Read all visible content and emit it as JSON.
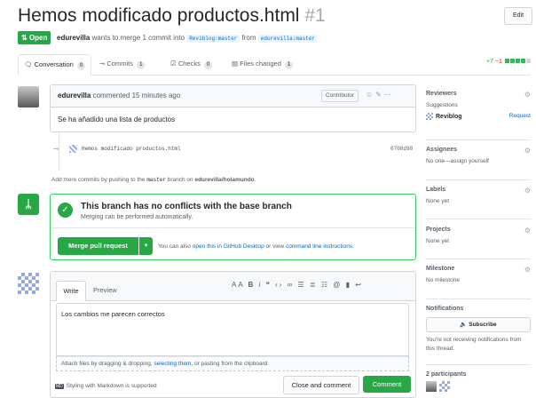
{
  "header": {
    "title": "Hemos modificado productos.html",
    "number": "#1",
    "edit_label": "Edit",
    "status": "Open",
    "author": "edurevilla",
    "meta_text": " wants to merge 1 commit into ",
    "base_branch": "Reviblog:master",
    "from_text": " from ",
    "head_branch": "edurevilla:master"
  },
  "tabs": [
    {
      "label": "Conversation",
      "count": "0"
    },
    {
      "label": "Commits",
      "count": "1"
    },
    {
      "label": "Checks",
      "count": "0"
    },
    {
      "label": "Files changed",
      "count": "1"
    }
  ],
  "diffstat": {
    "additions": "+7",
    "deletions": "−1"
  },
  "comment": {
    "author": "edurevilla",
    "when": " commented 15 minutes ago",
    "badge": "Contributor",
    "body": "Se ha añadido una lista de productos"
  },
  "commit": {
    "message": "Hemos modificado productos.html",
    "sha": "0708d98"
  },
  "hint": {
    "pre": "Add more commits by pushing to the ",
    "branch": "master",
    "mid": " branch on ",
    "repo": "edurevilla/holamundo",
    "post": "."
  },
  "merge": {
    "title": "This branch has no conflicts with the base branch",
    "subtitle": "Merging can be performed automatically.",
    "button": "Merge pull request",
    "alt_pre": "You can also ",
    "alt_link1": "open this in GitHub Desktop",
    "alt_mid": " or view ",
    "alt_link2": "command line instructions",
    "alt_post": "."
  },
  "editor": {
    "tab_write": "Write",
    "tab_preview": "Preview",
    "text": "Los cambios me parecen correctos",
    "attach_pre": "Attach files by dragging & dropping, ",
    "attach_link": "selecting them",
    "attach_post": ", or pasting from the clipboard.",
    "md_icon": "MD",
    "md_note": "Styling with Markdown is supported",
    "close_label": "Close and comment",
    "comment_label": "Comment"
  },
  "sidebar": {
    "reviewers": {
      "title": "Reviewers",
      "suggestions": "Suggestions",
      "name": "Reviblog",
      "request": "Request"
    },
    "assignees": {
      "title": "Assignees",
      "value": "No one—assign yourself"
    },
    "labels": {
      "title": "Labels",
      "value": "None yet"
    },
    "projects": {
      "title": "Projects",
      "value": "None yet"
    },
    "milestone": {
      "title": "Milestone",
      "value": "No milestone"
    },
    "notifications": {
      "title": "Notifications",
      "button": "Subscribe",
      "note": "You're not receiving notifications from this thread."
    },
    "participants": {
      "title": "2 participants"
    }
  }
}
